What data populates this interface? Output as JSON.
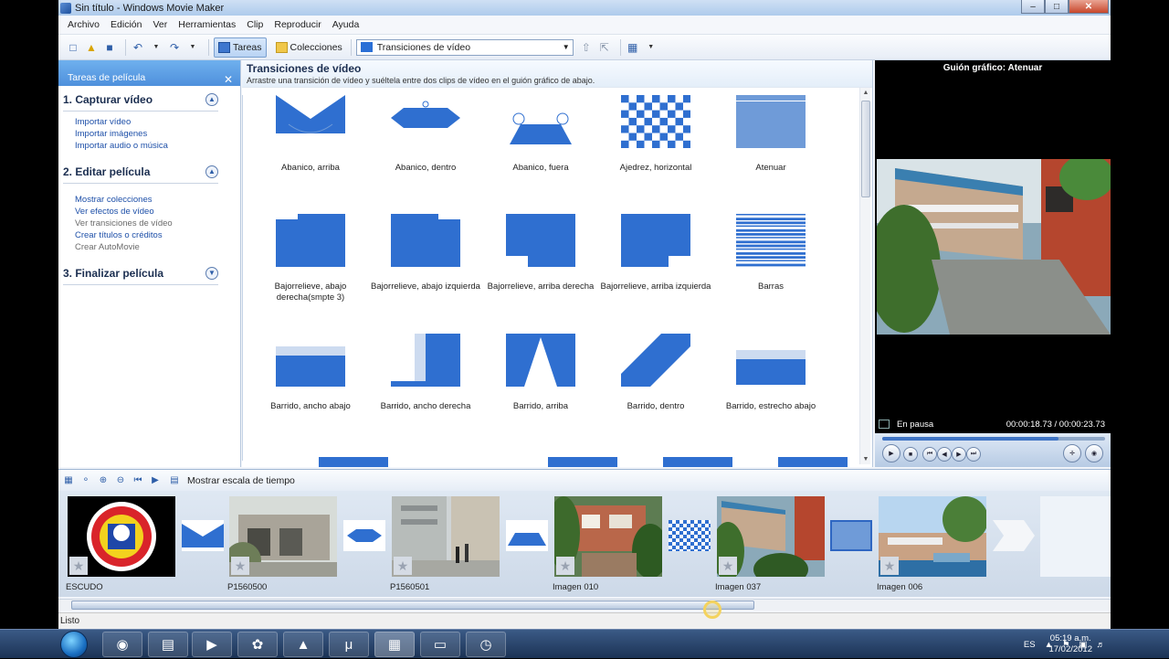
{
  "window": {
    "title": "Sin título - Windows Movie Maker",
    "controls": {
      "min": "–",
      "max": "□",
      "close": "✕"
    }
  },
  "menu": [
    "Archivo",
    "Edición",
    "Ver",
    "Herramientas",
    "Clip",
    "Reproducir",
    "Ayuda"
  ],
  "toolbar": {
    "tareas": "Tareas",
    "colecciones": "Colecciones",
    "combo_value": "Transiciones de vídeo"
  },
  "tasks": {
    "header": "Tareas de película",
    "close": "✕",
    "sections": [
      {
        "title": "1. Capturar vídeo",
        "links": [
          "Importar vídeo",
          "Importar imágenes",
          "Importar audio o música"
        ]
      },
      {
        "title": "2. Editar película",
        "links": [
          "Mostrar colecciones",
          "Ver efectos de vídeo",
          "Ver transiciones de vídeo",
          "Crear títulos o créditos",
          "Crear AutoMovie"
        ]
      },
      {
        "title": "3. Finalizar película",
        "links": []
      }
    ]
  },
  "content": {
    "title": "Transiciones de vídeo",
    "subtitle": "Arrastre una transición de vídeo y suéltela entre dos clips de vídeo en el guión gráfico de abajo.",
    "transitions": [
      "Abanico, arriba",
      "Abanico, dentro",
      "Abanico, fuera",
      "Ajedrez, horizontal",
      "Atenuar",
      "Bajorrelieve, abajo derecha(smpte 3)",
      "Bajorrelieve, abajo izquierda",
      "Bajorrelieve, arriba derecha",
      "Bajorrelieve, arriba izquierda",
      "Barras",
      "Barrido, ancho abajo",
      "Barrido, ancho derecha",
      "Barrido, arriba",
      "Barrido, dentro",
      "Barrido, estrecho abajo"
    ]
  },
  "preview": {
    "header": "Guión gráfico: Atenuar",
    "status": "En pausa",
    "timecode": "00:00:18.73 / 00:00:23.73",
    "progress": 0.79
  },
  "storyboard": {
    "toggle_label": "Mostrar escala de tiempo",
    "clips": [
      "ESCUDO",
      "P1560500",
      "P1560501",
      "Imagen 010",
      "Imagen 037",
      "Imagen 006"
    ]
  },
  "statusbar": "Listo",
  "taskbar": {
    "lang": "ES",
    "time": "05:19 a.m.",
    "date": "17/02/2012"
  }
}
